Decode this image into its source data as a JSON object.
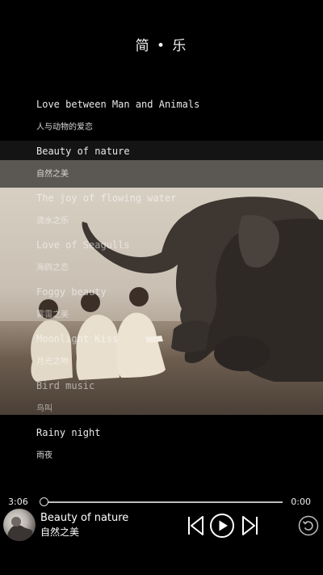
{
  "app": {
    "title": "简 • 乐"
  },
  "songs": [
    {
      "en": "Love between Man and Animals",
      "zh": "人与动物的爱恋"
    },
    {
      "en": "Beauty of nature",
      "zh": "自然之美"
    },
    {
      "en": "The joy of flowing water",
      "zh": "流水之乐"
    },
    {
      "en": "Love of Seagulls",
      "zh": "海鸥之恋"
    },
    {
      "en": "Foggy beauty",
      "zh": "雾霭之美"
    },
    {
      "en": "Moonlight Kiss",
      "zh": "月光之吻"
    },
    {
      "en": "Bird music",
      "zh": "鸟叫"
    },
    {
      "en": "Rainy night",
      "zh": "雨夜"
    }
  ],
  "player": {
    "elapsed": "3:06",
    "remaining": "0:00",
    "progress": 0.0,
    "title_en": "Beauty of nature",
    "title_zh": "自然之美"
  }
}
